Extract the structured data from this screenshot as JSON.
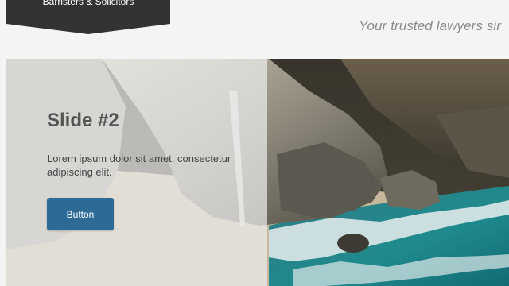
{
  "header": {
    "logo_subtitle": "Barristers & Solicitors",
    "tagline": "Your trusted lawyers sir"
  },
  "slider": {
    "current_slide": {
      "title": "Slide #2",
      "text": "Lorem ipsum dolor sit amet, consectetur adipiscing elit.",
      "button_label": "Button"
    }
  },
  "colors": {
    "logo_banner": "#333333",
    "button": "#2d6a95",
    "background": "#f4f4f4"
  }
}
